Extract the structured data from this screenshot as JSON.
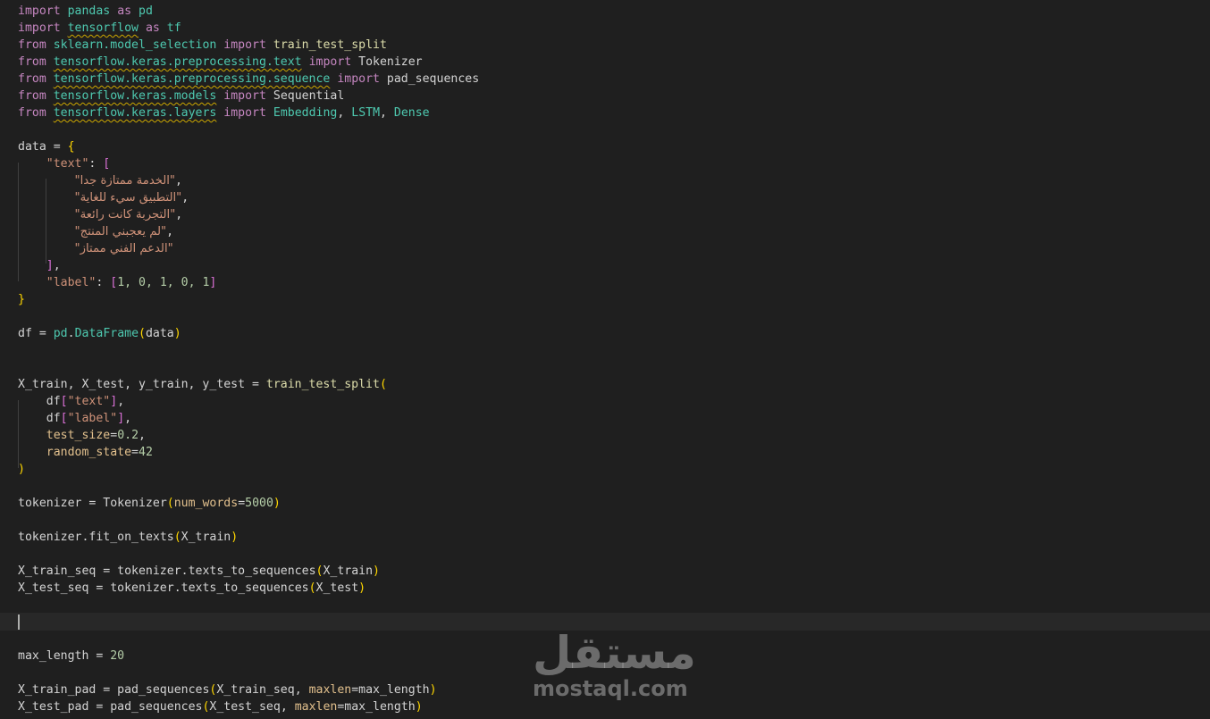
{
  "editor": {
    "lines": {
      "l1": {
        "a": "import",
        "b": "pandas",
        "c": "as",
        "d": "pd"
      },
      "l2": {
        "a": "import",
        "b": "tensorflow",
        "c": "as",
        "d": "tf"
      },
      "l3": {
        "a": "from",
        "b": "sklearn.model_selection",
        "c": "import",
        "d": "train_test_split"
      },
      "l4": {
        "a": "from",
        "b": "tensorflow.keras.preprocessing.text",
        "c": "import",
        "d": "Tokenizer"
      },
      "l5": {
        "a": "from",
        "b": "tensorflow.keras.preprocessing.sequence",
        "c": "import",
        "d": "pad_sequences"
      },
      "l6": {
        "a": "from",
        "b": "tensorflow.keras.models",
        "c": "import",
        "d": "Sequential"
      },
      "l7": {
        "a": "from",
        "b": "tensorflow.keras.layers",
        "c": "import",
        "d": "Embedding",
        "e": "LSTM",
        "f": "Dense"
      },
      "data_var": "data",
      "text_key": "\"text\"",
      "ar1": "\"الخدمة ممتازة جدا\"",
      "ar2": "\"التطبيق سيء للغاية\"",
      "ar3": "\"التجربة كانت رائعة\"",
      "ar4": "\"لم يعجبني المنتج\"",
      "ar5": "\"الدعم الفني ممتاز\"",
      "label_key": "\"label\"",
      "labels": "1, 0, 1, 0, 1",
      "df": "df",
      "pd": "pd",
      "DataFrame": "DataFrame",
      "split_lhs": "X_train, X_test, y_train, y_test",
      "split_fn": "train_test_split",
      "df_text": "\"text\"",
      "df_label": "\"label\"",
      "test_size_kw": "test_size",
      "test_size_val": "0.2",
      "rs_kw": "random_state",
      "rs_val": "42",
      "tokenizer": "tokenizer",
      "Tokenizer": "Tokenizer",
      "num_words_kw": "num_words",
      "num_words_val": "5000",
      "fit_fn": "fit_on_texts",
      "X_train": "X_train",
      "X_test": "X_test",
      "X_train_seq": "X_train_seq",
      "X_test_seq": "X_test_seq",
      "tts_fn": "texts_to_sequences",
      "max_length": "max_length",
      "max_length_val": "20",
      "X_train_pad": "X_train_pad",
      "X_test_pad": "X_test_pad",
      "pad_fn": "pad_sequences",
      "maxlen_kw": "maxlen"
    }
  },
  "watermark": {
    "arabic": "مستقل",
    "latin": "mostaql.com"
  }
}
